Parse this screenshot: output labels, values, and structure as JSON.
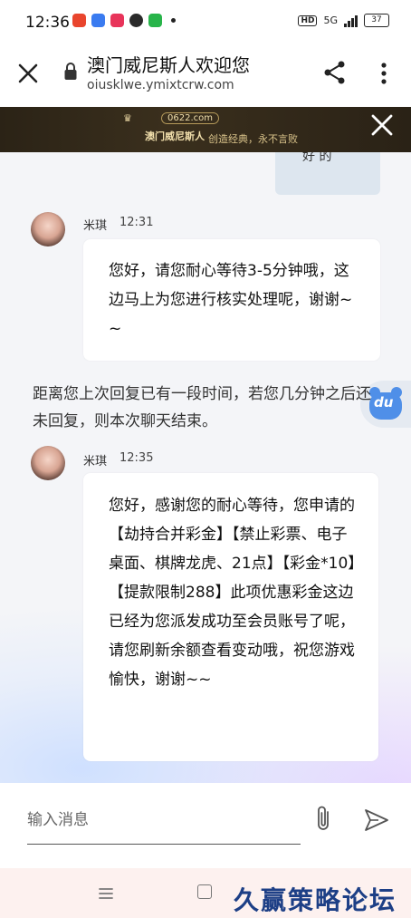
{
  "status_bar": {
    "time": "12:36",
    "hd": "HD",
    "network": "5G",
    "battery": "37",
    "app_colors": [
      "#e9452d",
      "#3a7bf0",
      "#e8345a",
      "#2a2a2a",
      "#28b44a"
    ]
  },
  "browser": {
    "title": "澳门威尼斯人欢迎您",
    "url": "oiusklwe.ymixtcrw.com"
  },
  "banner": {
    "site_code": "0622.com",
    "brand_name": "澳门威尼斯人",
    "slogan": "创造经典，永不言败"
  },
  "chat": {
    "previous_bubble_text": "好 的",
    "messages": [
      {
        "sender": "米琪",
        "time": "12:31",
        "text": "您好，请您耐心等待3-5分钟哦，这边马上为您进行核实处理呢，谢谢~~"
      },
      {
        "sender": "米琪",
        "time": "12:35",
        "text": "您好，感谢您的耐心等待，您申请的【劫持合并彩金】【禁止彩票、电子桌面、棋牌龙虎、21点】【彩金*10】【提款限制288】此项优惠彩金这边已经为您派发成功至会员账号了呢，请您刷新余额查看变动哦，祝您游戏愉快，谢谢~~"
      }
    ],
    "system_notice": "距离您上次回复已有一段时间，若您几分钟之后还未回复，则本次聊天结束。",
    "du_badge": "du"
  },
  "input": {
    "placeholder": "输入消息"
  },
  "watermark": "久赢策略论坛",
  "colors": {
    "accent_blue": "#4f8fe8",
    "bubble_bg": "#ffffff",
    "prev_bubble_bg": "#dde6ef",
    "watermark": "#1d3f86"
  }
}
